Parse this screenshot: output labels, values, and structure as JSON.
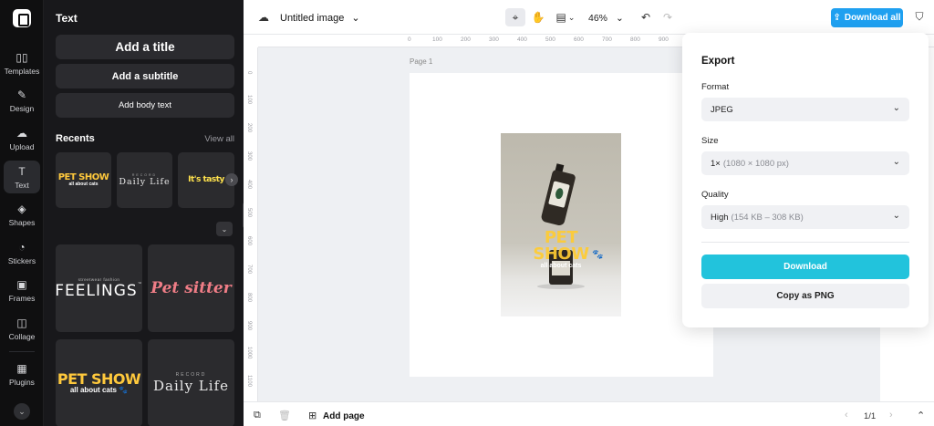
{
  "rail": {
    "items": [
      {
        "label": "Templates",
        "icon": "▯▯"
      },
      {
        "label": "Design",
        "icon": "✎"
      },
      {
        "label": "Upload",
        "icon": "☁"
      },
      {
        "label": "Text",
        "icon": "T"
      },
      {
        "label": "Shapes",
        "icon": "◈"
      },
      {
        "label": "Stickers",
        "icon": "◔"
      },
      {
        "label": "Frames",
        "icon": "▣"
      },
      {
        "label": "Collage",
        "icon": "◫"
      },
      {
        "label": "Plugins",
        "icon": "▦"
      }
    ],
    "expand_icon": "⌄"
  },
  "panel": {
    "title": "Text",
    "add_title": "Add a title",
    "add_subtitle": "Add a subtitle",
    "add_body": "Add body text",
    "recents_label": "Recents",
    "view_all": "View all",
    "next_arrow": "›",
    "collapse_chevron": "⌄",
    "templates": {
      "pet_show": "PET SHOW",
      "pet_show_sub": "all about cats",
      "paw": "🐾",
      "daily_life": "Daily Life",
      "record": "RECORD",
      "tasty": "It's tasty",
      "streetwear": "streetwear fashion",
      "feelings": "FEELINGS",
      "tm": "™",
      "pet_sitter": "Pet sitter"
    }
  },
  "topbar": {
    "cloud_icon": "☁",
    "doc_title": "Untitled image",
    "title_chevron": "⌄",
    "select_icon": "⌖",
    "hand_icon": "✋",
    "layout_icon": "▤",
    "layout_chevron": "⌄",
    "zoom": "46%",
    "zoom_chevron": "⌄",
    "undo_icon": "↶",
    "redo_icon": "↷",
    "download_all": "Download all",
    "upload_icon": "⇪",
    "shield_icon": "⛉"
  },
  "ruler": {
    "top": [
      "0",
      "100",
      "200",
      "300",
      "400",
      "500",
      "600",
      "700",
      "800",
      "900"
    ],
    "left": [
      "0",
      "100",
      "200",
      "300",
      "400",
      "500",
      "600",
      "700",
      "800",
      "900",
      "1000",
      "1100"
    ]
  },
  "canvas": {
    "page_label": "Page 1",
    "design_title": "PET SHOW",
    "design_sub": "all about cats",
    "paw": "🐾"
  },
  "bottombar": {
    "layers_icon": "⧉",
    "trash_icon": "🗑",
    "add_page_icon": "⊞",
    "add_page": "Add page",
    "prev_icon": "‹",
    "page_counter": "1/1",
    "next_icon": "›",
    "collapse_icon": "⌃"
  },
  "export": {
    "title": "Export",
    "format_label": "Format",
    "format_value": "JPEG",
    "size_label": "Size",
    "size_value": "1×",
    "size_detail": "(1080 × 1080 px)",
    "quality_label": "Quality",
    "quality_value": "High",
    "quality_detail": "(154 KB – 308 KB)",
    "chevron": "⌄",
    "download": "Download",
    "copy_png": "Copy as PNG"
  }
}
